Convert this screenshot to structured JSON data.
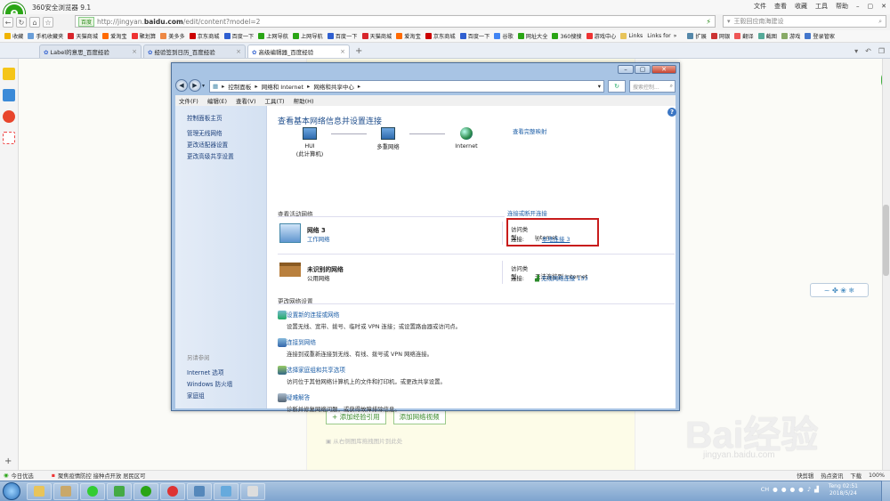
{
  "browser": {
    "app_name": "360安全浏览器 9.1",
    "menu": [
      "文件",
      "查看",
      "收藏",
      "工具",
      "帮助"
    ],
    "address_badge": "百度",
    "url_prefix": "http://jingyan.",
    "url_domain": "baidu.com",
    "url_suffix": "/edit/content?model=2",
    "search_placeholder": "王毅回应南海建设",
    "bookmarks": [
      "收藏",
      "手机收藏夹",
      "天猫商城",
      "爱淘宝",
      "聚划算",
      "美多多",
      "京东商城",
      "百度一下",
      "上网导航",
      "上网导航",
      "百度一下",
      "天猫商城",
      "爱淘宝",
      "京东商城",
      "百度一下",
      "谷歌",
      "网址大全",
      "360搜搜",
      "游戏中心",
      "Links",
      "Links for"
    ],
    "bookmark_right": [
      "扩展",
      "网银",
      "翻译",
      "截图",
      "游戏",
      "登录管家"
    ],
    "tabs": [
      {
        "label": "Label的意思_百度经验",
        "active": false
      },
      {
        "label": "经验签到日历_百度经验",
        "active": false
      },
      {
        "label": "高级编辑器_百度经验",
        "active": true
      }
    ],
    "new_tab": "+"
  },
  "page": {
    "add_ref_button": "+ 添加经验引用",
    "add_video_button": "添加网络视频",
    "no_pic_text": "从右侧图库拖拽图片到此处",
    "watermark": "Bai经验",
    "watermark_url": "jingyan.baidu.com",
    "float_widget": "~ ✤ ❀ ❄",
    "float_green": "68"
  },
  "explorer": {
    "breadcrumb": [
      "控制面板",
      "网络和 Internet",
      "网络和共享中心"
    ],
    "search_placeholder": "搜索控制...",
    "menu": [
      "文件(F)",
      "编辑(E)",
      "查看(V)",
      "工具(T)",
      "帮助(H)"
    ],
    "left_nav": [
      "控制面板主页",
      "管理无线网络",
      "更改适配器设置",
      "更改高级共享设置"
    ],
    "see_also_title": "另请参阅",
    "see_also": [
      "Internet 选项",
      "Windows 防火墙",
      "家庭组"
    ],
    "title": "查看基本网络信息并设置连接",
    "full_map": "查看完整映射",
    "nodes": [
      {
        "name": "HUI",
        "sub": "(此计算机)"
      },
      {
        "name": "多重网络",
        "sub": ""
      },
      {
        "name": "Internet",
        "sub": ""
      }
    ],
    "active_networks_heading": "查看活动网络",
    "connect_disconnect": "连接或断开连接",
    "networks": [
      {
        "name": "网络 3",
        "type": "工作网络",
        "access_label": "访问类型:",
        "access_value": "Internet",
        "conn_label": "连接:",
        "conn_value": "本地连接 3"
      },
      {
        "name": "未识别的网络",
        "type": "公用网络",
        "access_label": "访问类型:",
        "access_value": "无法连接到 Internet",
        "conn_label": "连接:",
        "conn_value": "无线网络连接 133"
      }
    ],
    "change_settings_heading": "更改网络设置",
    "tasks": [
      {
        "title": "设置新的连接或网络",
        "desc": "设置无线、宽带、拨号、临时或 VPN 连接；或设置路由器或访问点。"
      },
      {
        "title": "连接到网络",
        "desc": "连接到或重新连接到无线、有线、拨号或 VPN 网络连接。"
      },
      {
        "title": "选择家庭组和共享选项",
        "desc": "访问位于其他网络计算机上的文件和打印机，或更改共享设置。"
      },
      {
        "title": "疑难解答",
        "desc": "诊断并修复网络问题，或获得故障排除信息。"
      }
    ]
  },
  "status": {
    "left": "今日优选",
    "news": "聚焦疫情防控 接种点开放 居民区可",
    "right": [
      "快剪辑",
      "热点资讯",
      "下载",
      "100%"
    ]
  },
  "taskbar": {
    "tray_lang": "CH",
    "time": "02:51",
    "user": "Teng",
    "date": "2018/5/24"
  },
  "colors": {
    "highlight": "#c81c1c",
    "link": "#1b5da6",
    "brand_green": "#2aa515"
  }
}
